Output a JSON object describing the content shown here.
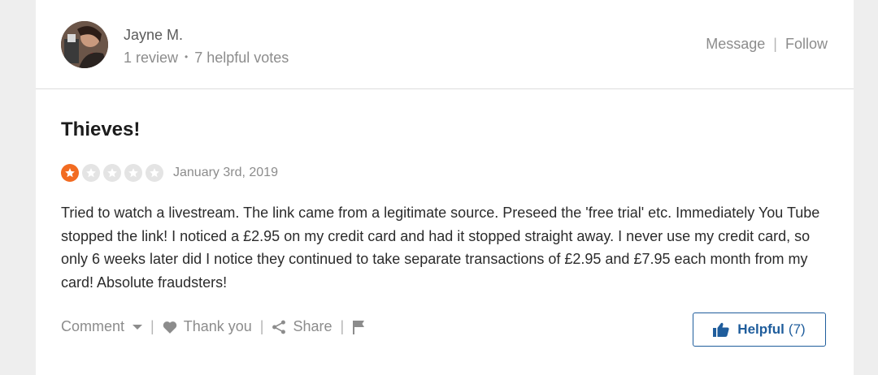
{
  "reviewer": {
    "name": "Jayne M.",
    "review_count": "1 review",
    "separator_dot": "•",
    "helpful_votes": "7 helpful votes"
  },
  "header_actions": {
    "message_label": "Message",
    "separator": "|",
    "follow_label": "Follow"
  },
  "review": {
    "title": "Thieves!",
    "rating": 1,
    "rating_max": 5,
    "date": "January 3rd, 2019",
    "body": "Tried to watch a livestream. The link came from a legitimate source. Preseed the 'free trial' etc. Immediately You Tube stopped the link! I noticed a £2.95 on my credit card and had it stopped straight away. I never use my credit card, so only 6 weeks later did I notice they continued to take separate transactions of £2.95 and £7.95 each month from my card! Absolute fraudsters!"
  },
  "footer": {
    "comment_label": "Comment",
    "thank_you_label": "Thank you",
    "share_label": "Share",
    "separator": "|",
    "helpful_label": "Helpful",
    "helpful_count": "(7)"
  },
  "icons": {
    "avatar": "avatar-photo",
    "star": "star-icon",
    "heart": "heart-icon",
    "share": "share-icon",
    "flag": "flag-icon",
    "thumbs_up": "thumbs-up-icon",
    "caret": "chevron-down-icon"
  },
  "colors": {
    "star_filled": "#f26b21",
    "star_empty": "#e4e4e4",
    "accent_blue": "#1f5d9c",
    "muted_text": "#8c8c8c"
  }
}
